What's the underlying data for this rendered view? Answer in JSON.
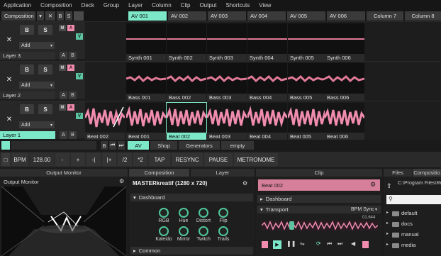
{
  "menu": [
    "Application",
    "Composition",
    "Deck",
    "Group",
    "Layer",
    "Column",
    "Clip",
    "Output",
    "Shortcuts",
    "View"
  ],
  "header": {
    "composition_label": "Composition",
    "columns": [
      "AV 001",
      "AV 002",
      "AV 003",
      "AV 004",
      "AV 005",
      "AV 006",
      "Column 7",
      "Column 8"
    ]
  },
  "layer_controls": {
    "mute": "M",
    "bypass": "B",
    "solo": "S",
    "add": "Add",
    "a": "A",
    "b": "B",
    "v": "V"
  },
  "layers": [
    {
      "name": "Layer 3",
      "clips": [
        "Synth 001",
        "Synth 002",
        "Synth 003",
        "Synth 004",
        "Synth 005",
        "Synth 006"
      ]
    },
    {
      "name": "Layer 2",
      "clips": [
        "Bass 001",
        "Bass 002",
        "Bass 003",
        "Bass 004",
        "Bass 005",
        "Bass 006"
      ]
    },
    {
      "name": "Layer 1",
      "clips": [
        "Beat 001",
        "Beat 002",
        "Beat 003",
        "Beat 004",
        "Beat 005",
        "Beat 006"
      ]
    }
  ],
  "layer1_extra_clip": "Beat 002",
  "deck": {
    "b": "B",
    "tabs": [
      "AV",
      "Shop",
      "Generators",
      "empty"
    ]
  },
  "transport": {
    "bpm_label": "BPM",
    "bpm_value": "128.00",
    "buttons": [
      "-",
      "+",
      "-|",
      "|+",
      "/2",
      "*2",
      "TAP",
      "RESYNC",
      "PAUSE",
      "METRONOME"
    ]
  },
  "output_monitor": {
    "title": "Output Monitor",
    "label": "Output Monitor"
  },
  "composition_panel": {
    "tabs": [
      "Composition",
      "Layer"
    ],
    "name": "MASTERkreatif (1280 x 720)",
    "dashboard": "Dashboard",
    "knobs": [
      "RGB",
      "Hue",
      "Distort",
      "Flip",
      "Kaleido",
      "Mirror",
      "Twitch",
      "Trails"
    ],
    "common": "Common"
  },
  "clip_panel": {
    "title": "Clip",
    "clip_name": "Beat 002",
    "dashboard": "Dashboard",
    "transport": "Transport",
    "sync_mode": "BPM Sync",
    "time": "01.644",
    "position": 0.25
  },
  "files_panel": {
    "tabs": [
      "Files",
      "Compositio"
    ],
    "path": "C:\\Program Files\\Re",
    "folders": [
      "default",
      "docs",
      "manual",
      "media"
    ]
  },
  "colors": {
    "accent": "#7de8c8",
    "pink": "#f08cae",
    "knob": "#4fc79a"
  }
}
